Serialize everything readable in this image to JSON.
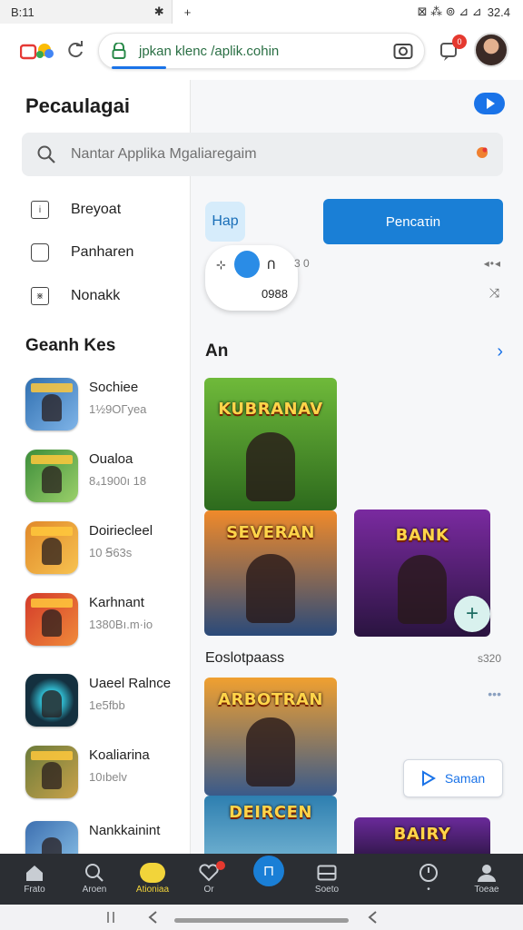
{
  "status_bar": {
    "time": "B:11",
    "tab_icon": "✱",
    "tab_plus": "+",
    "right_icons_text": "⊠ ⁂ ⊚ ⊿ ⊿",
    "battery": "32.4"
  },
  "browser": {
    "url": "jpkan klenc /aplik.cohin",
    "notification_count": "0"
  },
  "sidebar": {
    "title": "Pecaulagai",
    "nav": [
      {
        "label": "Breyoat",
        "icon": "info-box-icon"
      },
      {
        "label": "Panharen",
        "icon": "folder-icon"
      },
      {
        "label": "Nonakk",
        "icon": "grid-icon"
      }
    ],
    "section_title": "Geanh Kes",
    "games": [
      {
        "title": "Sochiee",
        "sub": "1½9ОГyea",
        "color": "#2f6fb0"
      },
      {
        "title": "Oualoa",
        "sub": "8₄1900ı 18",
        "color": "#3c8d3a"
      },
      {
        "title": "Doiriecleel",
        "sub": "10 Ꞩ63s",
        "color": "#e0892a"
      },
      {
        "title": "Karhnant",
        "sub": "1380Bı.m·io",
        "color": "#d33a2a"
      },
      {
        "title": "Uaeel Ralnce",
        "sub": "1e5fbb",
        "color": "#14303f"
      },
      {
        "title": "Koaliarina",
        "sub": "10ıbelv",
        "color": "#6b7b3a"
      },
      {
        "title": "Nankkainint",
        "sub": "",
        "color": "#3d6fb0"
      }
    ]
  },
  "search": {
    "placeholder": "Nantar Applika Mgaliaregaim"
  },
  "main": {
    "chip_label": "Hap",
    "primary_button": "Pencaτin",
    "pill": {
      "a": "⊹",
      "b": "ᑎ",
      "c": "0988"
    },
    "zero_label": "3 0",
    "dots1": "◂•◂",
    "share_icon": "⤨",
    "section1_title": "An",
    "section1_chevron": "›",
    "cards": [
      {
        "label": "KUBRANAV",
        "bg": "#3f8b2d"
      },
      {
        "label": "SEVERAN",
        "bg": "#c0612a"
      },
      {
        "label": "BANK",
        "bg": "#5a2a7a"
      },
      {
        "label": "ARBOTRAN",
        "bg": "#d08a2a"
      },
      {
        "label": "DEIRCEN",
        "bg": "#2e7fb0"
      },
      {
        "label": "BAIRY",
        "bg": "#4a2a6a"
      }
    ],
    "section2_title": "Eoslotpaass",
    "section2_meta": "s320",
    "dots2": "•••",
    "save_button": "Saman",
    "fab_label": "+"
  },
  "bottom_nav": [
    {
      "label": "Frato",
      "icon": "home-icon"
    },
    {
      "label": "Aroen",
      "icon": "search-icon"
    },
    {
      "label": "Ationiaa",
      "icon": "active-icon"
    },
    {
      "label": "Or",
      "icon": "heart-icon"
    },
    {
      "label": "",
      "icon": "center-icon"
    },
    {
      "label": "Soeto",
      "icon": "mail-icon"
    },
    {
      "label": "•",
      "icon": "clock-icon"
    },
    {
      "label": "Toeae",
      "icon": "profile-icon"
    }
  ],
  "colors": {
    "accent": "#1a73e8",
    "nav_bg": "#2b2e33",
    "badge": "#e5392f"
  }
}
